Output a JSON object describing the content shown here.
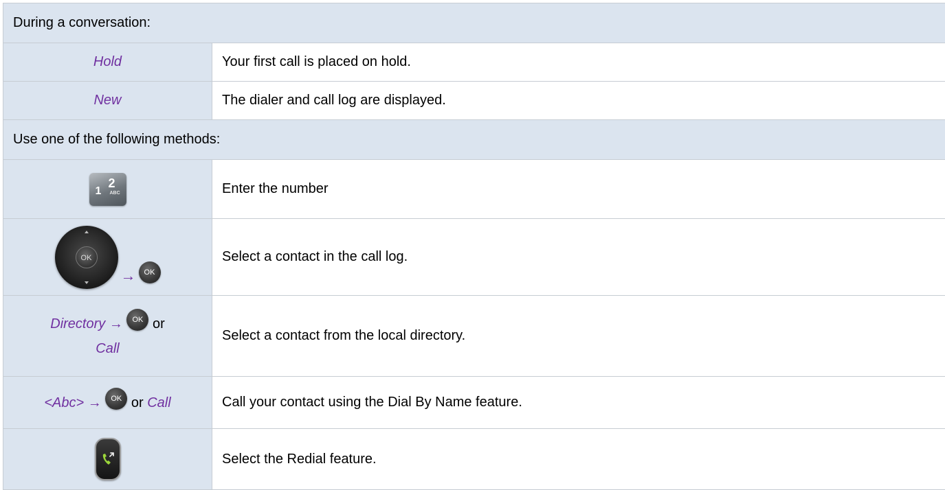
{
  "header_conversation": "During a conversation:",
  "rows_top": [
    {
      "control": "Hold",
      "description": "Your first call is placed on hold."
    },
    {
      "control": "New",
      "description": "The dialer and call log are displayed."
    }
  ],
  "header_methods": "Use one of the following methods:",
  "keypad": {
    "key1": "1",
    "key2": "2",
    "letters": "ABC",
    "description": "Enter the number"
  },
  "navigator": {
    "ok_label": "OK",
    "arrow": "→",
    "description": "Select a contact in the call log."
  },
  "directory": {
    "label": "Directory",
    "arrow": "→",
    "ok_label": "OK",
    "or": "or",
    "call": "Call",
    "description": "Select a contact from the local directory."
  },
  "dial_by_name": {
    "label": "<Abc>",
    "arrow": "→",
    "ok_label": "OK",
    "or": "or",
    "call": "Call",
    "description": "Call your contact using the Dial By Name feature."
  },
  "redial": {
    "icon": "redial-phone-icon",
    "description": "Select the Redial feature."
  },
  "colors": {
    "header_bg": "#dbe4ef",
    "control_text": "#7030a0",
    "border": "#c6ccd3"
  }
}
